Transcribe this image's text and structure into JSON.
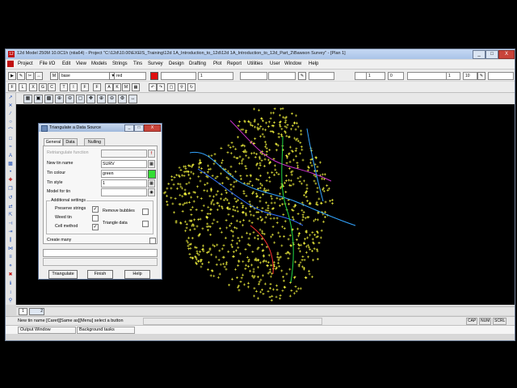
{
  "window": {
    "title": "12d Model 250M 10.0C1h (ntia64) - Project \"C:\\12d\\10.00\\EXEIS_Training\\12d 1A_Introduction_to_12d\\12d 1A_Introduction_to_12d_Part_2\\Bawson Survey\" - [Plan 1]",
    "minimize": "_",
    "maximize": "□",
    "close": "X"
  },
  "menubar": [
    "Project",
    "File I/O",
    "Edit",
    "View",
    "Models",
    "Strings",
    "Tins",
    "Survey",
    "Design",
    "Drafting",
    "Plot",
    "Report",
    "Utilities",
    "User",
    "Window",
    "Help"
  ],
  "toolbar": {
    "model_field": "base",
    "colour_field": "red",
    "colour_swatch": "#e01010",
    "weight_field": "1",
    "number_1": "1",
    "number_2": "0",
    "number_3": "1",
    "number_4": "10",
    "row2_letters": [
      "F",
      "L",
      "X",
      "G",
      "C",
      "T",
      "I",
      "F",
      "F",
      "A",
      "K",
      "M"
    ]
  },
  "view": {
    "background": "#000000",
    "survey_points_color": "#ffff40",
    "contour_colors": [
      "#33a4ff",
      "#3070ff",
      "#cc33cc",
      "#22dd44",
      "#ff3030"
    ]
  },
  "bottom_tabs": [
    "1",
    "2"
  ],
  "status": {
    "message": "New tin name [Caret][Same as][Menu] select a button",
    "caps": "CAP",
    "num": "NUM",
    "scroll": "SCRL"
  },
  "output": {
    "tab1": "Output Window",
    "tab2": "Background tasks"
  },
  "dialog": {
    "title": "Triangulate a Data Source",
    "tabs": [
      "General",
      "Data",
      "Nulling"
    ],
    "retriangulate_label": "Retriangulate function",
    "new_tin_label": "New tin name",
    "new_tin_value": "SURV",
    "tin_colour_label": "Tin colour",
    "tin_colour_value": "green",
    "tin_colour_swatch": "#33dd33",
    "tin_style_label": "Tin style",
    "tin_style_value": "1",
    "model_for_tin_label": "Model for tin",
    "model_for_tin_value": "",
    "additional_label": "Additional settings",
    "preserve_strings_label": "Preserve strings",
    "preserve_strings_checked": true,
    "weed_tin_label": "Weed tin",
    "weed_tin_checked": false,
    "cell_method_label": "Cell method",
    "cell_method_checked": true,
    "remove_bubbles_label": "Remove bubbles",
    "remove_bubbles_checked": false,
    "triangle_data_label": "Triangle data",
    "triangle_data_checked": false,
    "create_many_label": "Create many",
    "create_many_checked": false,
    "btn_triangulate": "Triangulate",
    "btn_finish": "Finish",
    "btn_help": "Help"
  }
}
